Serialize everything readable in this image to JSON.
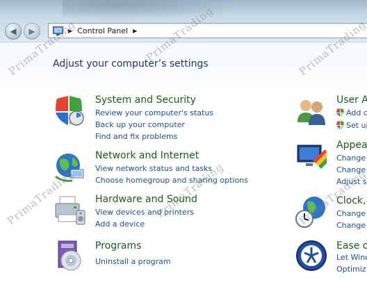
{
  "address_bar": {
    "breadcrumb": "Control Panel",
    "separator": "▶"
  },
  "heading": "Adjust your computer’s settings",
  "categories_left": [
    {
      "title": "System and Security",
      "icon": "shield-icon",
      "links": [
        "Review your computer's status",
        "Back up your computer",
        "Find and fix problems"
      ]
    },
    {
      "title": "Network and Internet",
      "icon": "network-globe-icon",
      "links": [
        "View network status and tasks",
        "Choose homegroup and sharing options"
      ]
    },
    {
      "title": "Hardware and Sound",
      "icon": "printer-icon",
      "links": [
        "View devices and printers",
        "Add a device"
      ]
    },
    {
      "title": "Programs",
      "icon": "programs-disc-icon",
      "links": [
        "Uninstall a program"
      ]
    }
  ],
  "categories_right": [
    {
      "title": "User A",
      "icon": "users-icon",
      "links": [
        "Add c",
        "Set up"
      ]
    },
    {
      "title": "Appea",
      "icon": "appearance-monitor-icon",
      "links": [
        "Change",
        "Change",
        "Adjust s"
      ]
    },
    {
      "title": "Clock,",
      "icon": "clock-globe-icon",
      "links": [
        "Change",
        "Change"
      ]
    },
    {
      "title": "Ease o",
      "icon": "ease-of-access-icon",
      "links": [
        "Let Wind",
        "Optimiz"
      ]
    }
  ],
  "watermark": "PrimaTrading",
  "colors": {
    "heading": "#1e3287",
    "category_title": "#1e5a1e",
    "link": "#1f4ea1"
  }
}
